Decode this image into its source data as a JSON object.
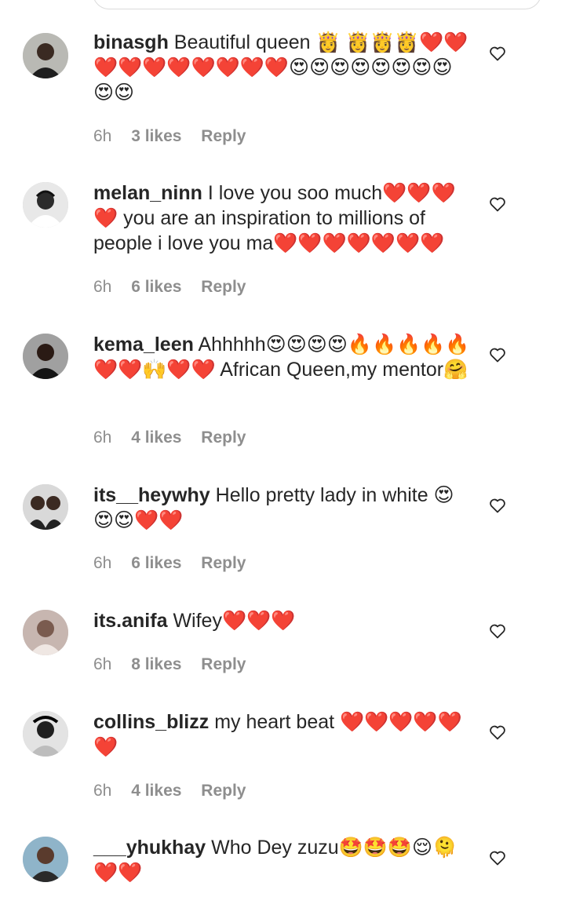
{
  "comments": [
    {
      "username": "binasgh",
      "text": "Beautiful queen 👸 👸👸👸❤️❤️❤️❤️❤️❤️❤️❤️❤️❤️😍😍😍😍😍😍😍😍😍😍",
      "time": "6h",
      "likes": "3 likes",
      "reply": "Reply"
    },
    {
      "username": "melan_ninn",
      "text": "I love you soo much❤️❤️❤️❤️ you are an inspiration to millions of people i love you ma❤️❤️❤️❤️❤️❤️❤️",
      "time": "6h",
      "likes": "6 likes",
      "reply": "Reply"
    },
    {
      "username": "kema_leen",
      "text": "Ahhhhh😍😍😍😍🔥🔥🔥🔥🔥❤️❤️🙌❤️❤️ African Queen,my mentor🤗",
      "time": "6h",
      "likes": "4 likes",
      "reply": "Reply"
    },
    {
      "username": "its__heywhy",
      "text": "Hello pretty lady in white 😍😍😍❤️❤️",
      "time": "6h",
      "likes": "6 likes",
      "reply": "Reply"
    },
    {
      "username": "its.anifa",
      "text": "Wifey❤️❤️❤️",
      "time": "6h",
      "likes": "8 likes",
      "reply": "Reply"
    },
    {
      "username": "collins_blizz",
      "text": "my heart beat ❤️❤️❤️❤️❤️❤️",
      "time": "6h",
      "likes": "4 likes",
      "reply": "Reply"
    },
    {
      "username": "___yhukhay",
      "text": "Who Dey zuzu🤩🤩🤩😌🫠❤️❤️",
      "time": "",
      "likes": "",
      "reply": ""
    }
  ],
  "icons": {
    "like": "heart-outline-icon"
  },
  "colors": {
    "text": "#262626",
    "meta": "#8e8e8e"
  }
}
